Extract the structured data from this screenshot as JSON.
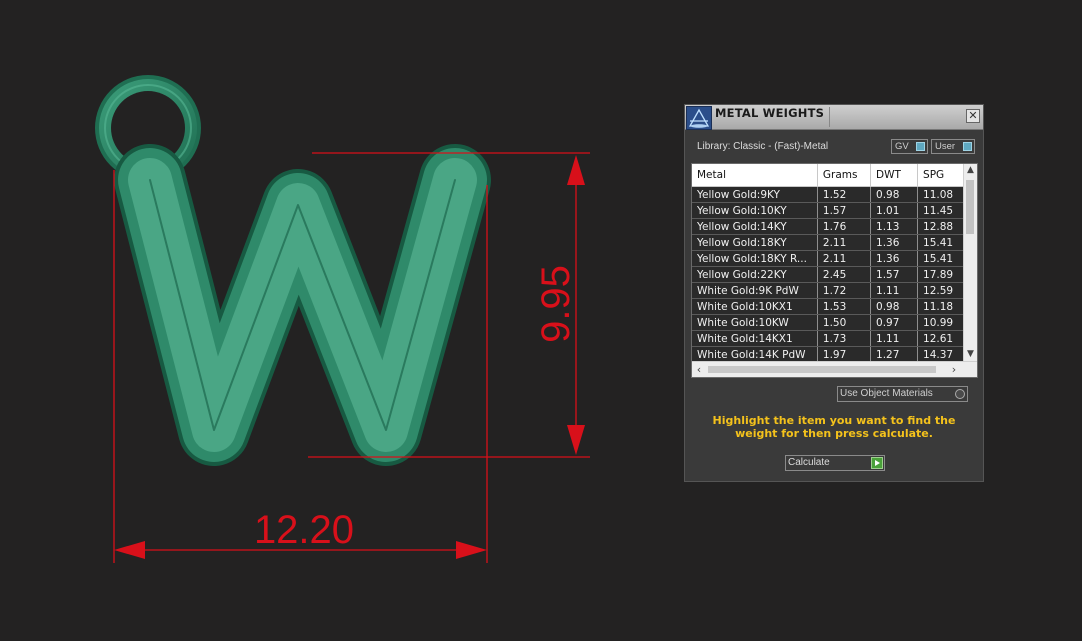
{
  "viewport": {
    "width_dimension": "12.20",
    "height_dimension": "9.95",
    "model_letter": "W",
    "colors": {
      "background": "#232222",
      "model_green": "#2f8a6a",
      "dimension_red": "#d8101a"
    }
  },
  "panel": {
    "title": "METAL WEIGHTS",
    "close_icon": "close-icon",
    "library_label": "Library: Classic - (Fast)-Metal",
    "gv_label": "GV",
    "user_label": "User",
    "table": {
      "headers": [
        "Metal",
        "Grams",
        "DWT",
        "SPG"
      ],
      "rows": [
        [
          "Yellow Gold:9KY",
          "1.52",
          "0.98",
          "11.08"
        ],
        [
          "Yellow Gold:10KY",
          "1.57",
          "1.01",
          "11.45"
        ],
        [
          "Yellow Gold:14KY",
          "1.76",
          "1.13",
          "12.88"
        ],
        [
          "Yellow Gold:18KY",
          "2.11",
          "1.36",
          "15.41"
        ],
        [
          "Yellow Gold:18KY R...",
          "2.11",
          "1.36",
          "15.41"
        ],
        [
          "Yellow Gold:22KY",
          "2.45",
          "1.57",
          "17.89"
        ],
        [
          "White Gold:9K PdW",
          "1.72",
          "1.11",
          "12.59"
        ],
        [
          "White Gold:10KX1",
          "1.53",
          "0.98",
          "11.18"
        ],
        [
          "White Gold:10KW",
          "1.50",
          "0.97",
          "10.99"
        ],
        [
          "White Gold:14KX1",
          "1.73",
          "1.11",
          "12.61"
        ],
        [
          "White Gold:14K PdW",
          "1.97",
          "1.27",
          "14.37"
        ]
      ]
    },
    "use_object_materials_label": "Use Object Materials",
    "help_text": "Highlight the item you want to find the weight for then press calculate.",
    "calculate_label": "Calculate",
    "accent_color": "#f4c21c"
  }
}
